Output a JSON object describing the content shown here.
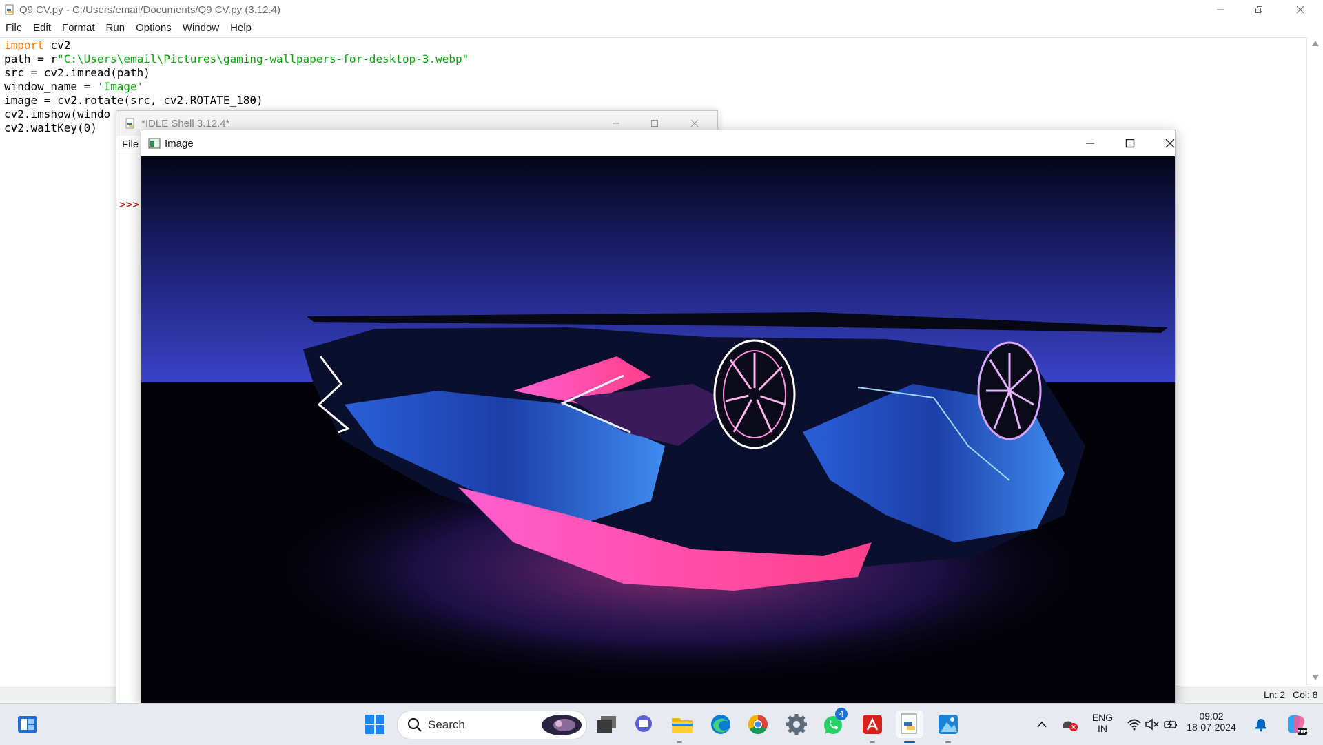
{
  "editor": {
    "title": "Q9 CV.py - C:/Users/email/Documents/Q9 CV.py (3.12.4)",
    "menu": [
      "File",
      "Edit",
      "Format",
      "Run",
      "Options",
      "Window",
      "Help"
    ],
    "code": {
      "l1_kw": "import",
      "l1_rest": " cv2",
      "l2_a": "path = r",
      "l2_str": "\"C:\\Users\\email\\Pictures\\gaming-wallpapers-for-desktop-3.webp\"",
      "l3": "src = cv2.imread(path)",
      "l4_a": "window_name = ",
      "l4_str": "'Image'",
      "l5": "image = cv2.rotate(src, cv2.ROTATE_180)",
      "l6": "cv2.imshow(windo",
      "l7": "cv2.waitKey(0)"
    },
    "status": {
      "ln": "Ln: 2",
      "col": "Col: 8"
    }
  },
  "shell": {
    "title": "*IDLE Shell 3.12.4*",
    "menu_file": "File",
    "prompt": ">>>"
  },
  "image_window": {
    "title": "Image",
    "content": "upside-down neon sports car wallpaper"
  },
  "taskbar": {
    "search_label": "Search",
    "apps": [
      "windows-logo",
      "task-view",
      "teams-chat",
      "file-explorer",
      "edge",
      "chrome",
      "settings",
      "whatsapp",
      "acrobat",
      "idle-python",
      "photos"
    ],
    "whatsapp_badge": "4",
    "lang_top": "ENG",
    "lang_bottom": "IN",
    "time": "09:02",
    "date": "18-07-2024"
  },
  "colors": {
    "accent": "#0067c0",
    "keyword": "#ff7700",
    "string": "#00aa00",
    "prompt": "#c00000"
  }
}
